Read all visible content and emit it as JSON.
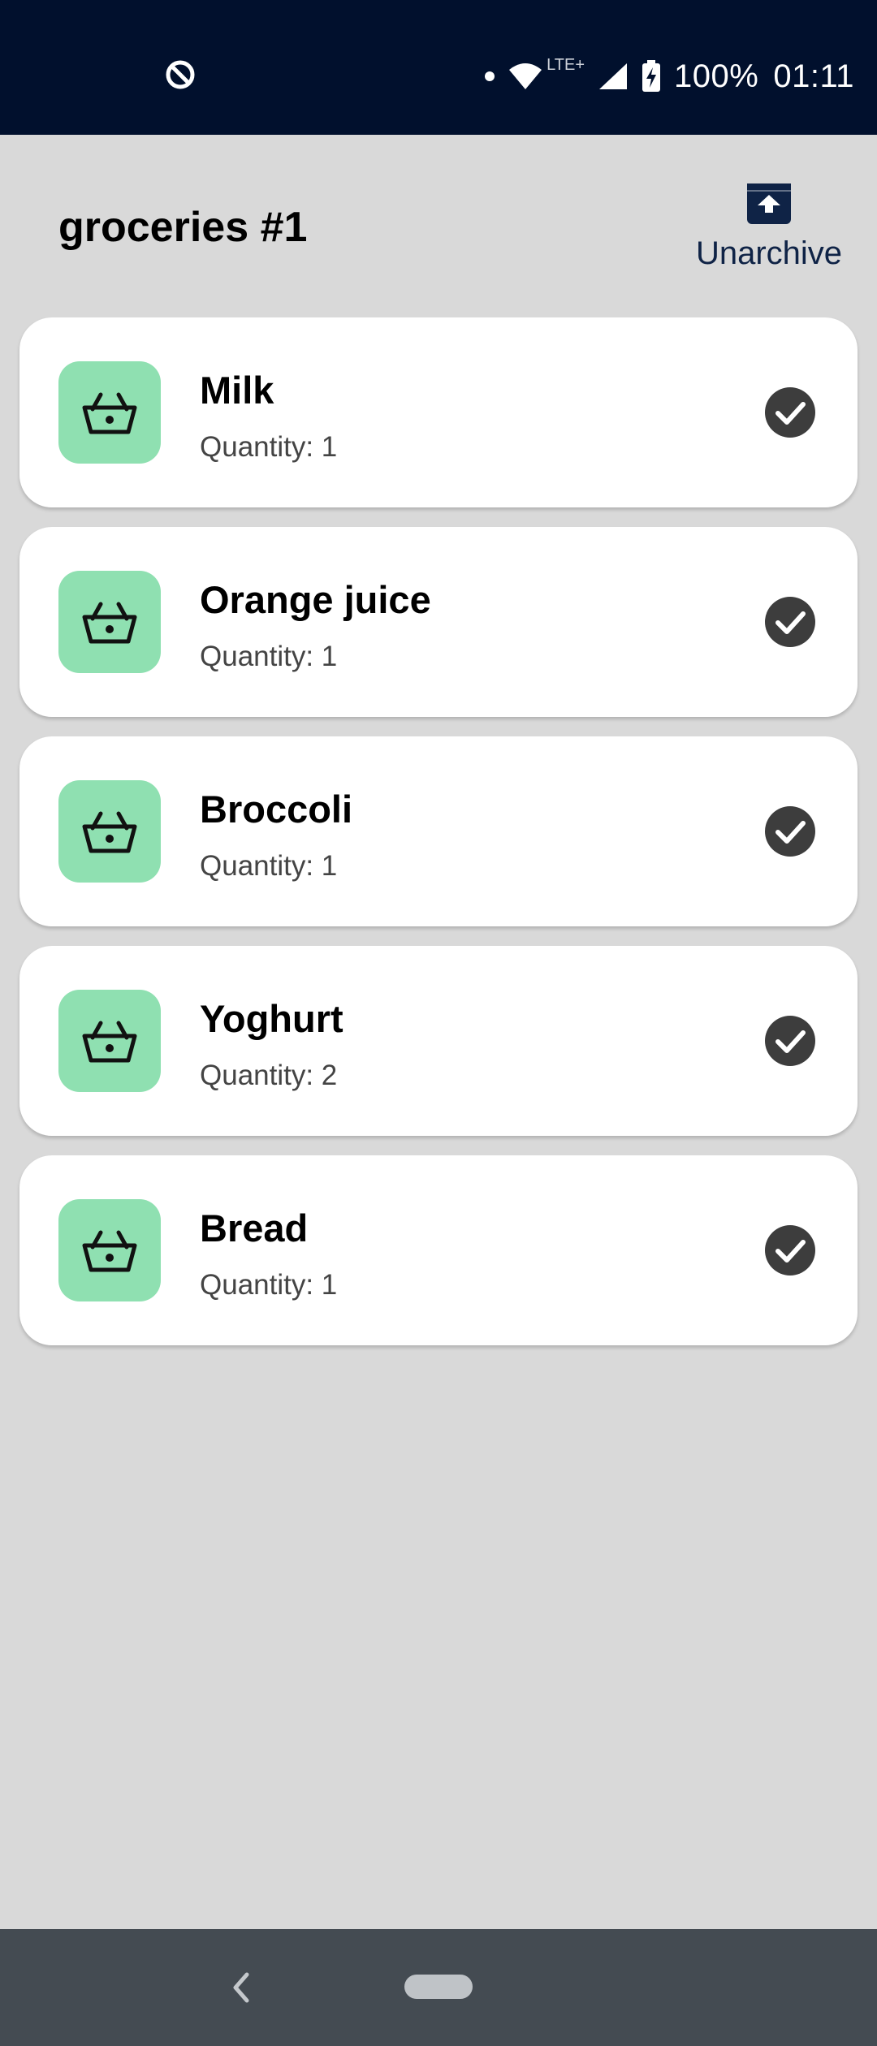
{
  "status_bar": {
    "battery": "100%",
    "time": "01:11",
    "network": "LTE+"
  },
  "header": {
    "title": "groceries #1",
    "unarchive_label": "Unarchive"
  },
  "items": [
    {
      "name": "Milk",
      "quantity": "Quantity: 1",
      "checked": true
    },
    {
      "name": "Orange juice",
      "quantity": "Quantity: 1",
      "checked": true
    },
    {
      "name": "Broccoli",
      "quantity": "Quantity: 1",
      "checked": true
    },
    {
      "name": "Yoghurt",
      "quantity": "Quantity: 2",
      "checked": true
    },
    {
      "name": "Bread",
      "quantity": "Quantity: 1",
      "checked": true
    }
  ],
  "colors": {
    "status_bar": "#01102d",
    "background": "#d9d9d9",
    "tile": "#8fe0b1",
    "check": "#3d3d3d",
    "nav_bar": "#444b52"
  },
  "icons": {
    "item": "shopping-basket-icon",
    "done": "check-circle-icon",
    "unarchive": "unarchive-icon"
  }
}
